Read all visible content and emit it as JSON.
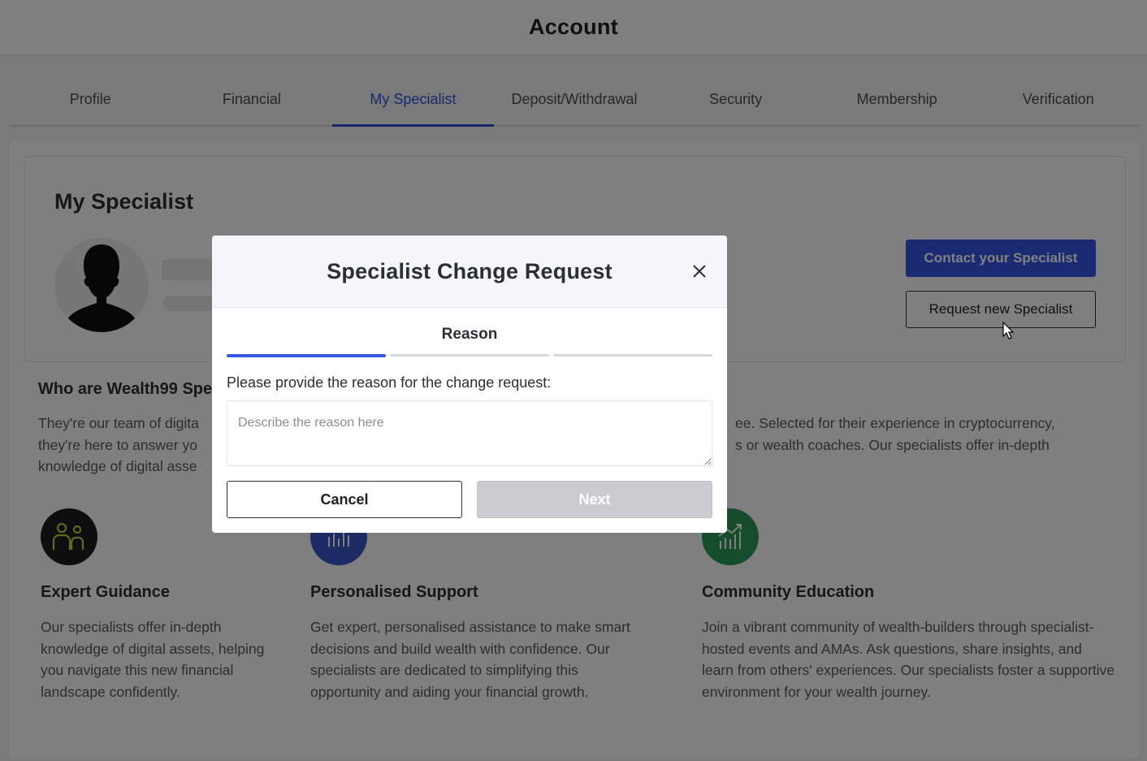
{
  "header": {
    "title": "Account"
  },
  "tabs": [
    {
      "label": "Profile"
    },
    {
      "label": "Financial"
    },
    {
      "label": "My Specialist",
      "active": true
    },
    {
      "label": "Deposit/Withdrawal"
    },
    {
      "label": "Security"
    },
    {
      "label": "Membership"
    },
    {
      "label": "Verification"
    }
  ],
  "specialist": {
    "title": "My Specialist",
    "contact_label": "Contact your Specialist",
    "request_label": "Request new Specialist"
  },
  "who": {
    "title": "Who are Wealth99 Spe",
    "text_left": "They're our team of digita\nthey're here to answer yo\nknowledge of digital asse",
    "text_right": "ee. Selected for their experience in cryptocurrency,\ns or wealth coaches. Our specialists offer in-depth"
  },
  "features": [
    {
      "title": "Expert Guidance",
      "text": "Our specialists offer in-depth knowledge of digital assets, helping you navigate this new financial landscape confidently.",
      "icon": "people-icon",
      "color": "#1a1c1f"
    },
    {
      "title": "Personalised Support",
      "text": "Get expert, personalised assistance to make smart decisions and build wealth with confidence. Our specialists are dedicated to simplifying this opportunity and aiding your financial growth.",
      "icon": "chart-bars-icon",
      "color": "#3b56c9"
    },
    {
      "title": "Community Education",
      "text": "Join a vibrant community of wealth-builders through specialist-hosted events and AMAs. Ask questions, share insights, and learn from others' experiences. Our specialists foster a supportive environment for your wealth journey.",
      "icon": "growth-chart-icon",
      "color": "#2a9a58"
    }
  ],
  "modal": {
    "title": "Specialist Change Request",
    "step_title": "Reason",
    "steps_total": 3,
    "current_step": 1,
    "prompt": "Please provide the reason for the change request:",
    "reason_placeholder": "Describe the reason here",
    "reason_value": "",
    "cancel_label": "Cancel",
    "next_label": "Next",
    "next_disabled": true
  },
  "colors": {
    "accent": "#3657e6",
    "overlay": "rgba(0,0,0,0.5)"
  }
}
